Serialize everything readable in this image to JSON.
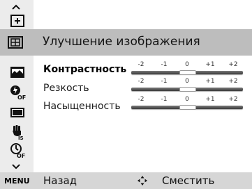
{
  "header": {
    "title": "Улучшение изображения"
  },
  "icons": {
    "scroll_up": "chevron-up-icon",
    "plus_frame": "plus-frame-icon",
    "image_adjust": "image-adjust-icon",
    "image_strip": "image-strip-icon",
    "flash_off": "flash-off-icon",
    "frame": "frame-icon",
    "hand_stabilizer": "hand-stabilizer-icon",
    "timer_off": "timer-off-icon",
    "scroll_down": "chevron-down-icon",
    "navigate": "four-way-navigation-icon"
  },
  "settings": [
    {
      "label": "Контрастность",
      "active": true,
      "scale": [
        "-2",
        "-1",
        "0",
        "+1",
        "+2"
      ],
      "value": 0
    },
    {
      "label": "Резкость",
      "active": false,
      "scale": [
        "-2",
        "-1",
        "0",
        "+1",
        "+2"
      ],
      "value": 0
    },
    {
      "label": "Насыщенность",
      "active": false,
      "scale": [
        "-2",
        "-1",
        "0",
        "+1",
        "+2"
      ],
      "value": 0
    }
  ],
  "footer": {
    "menu_key": "MENU",
    "back_label": "Назад",
    "move_label": "Сместить"
  },
  "colors": {
    "highlight": "#bdbdbd",
    "left_column": "#ececec",
    "bottom_bar": "#d6d6d6",
    "track": "#4a4a4a",
    "thumb": "#ffffff"
  }
}
